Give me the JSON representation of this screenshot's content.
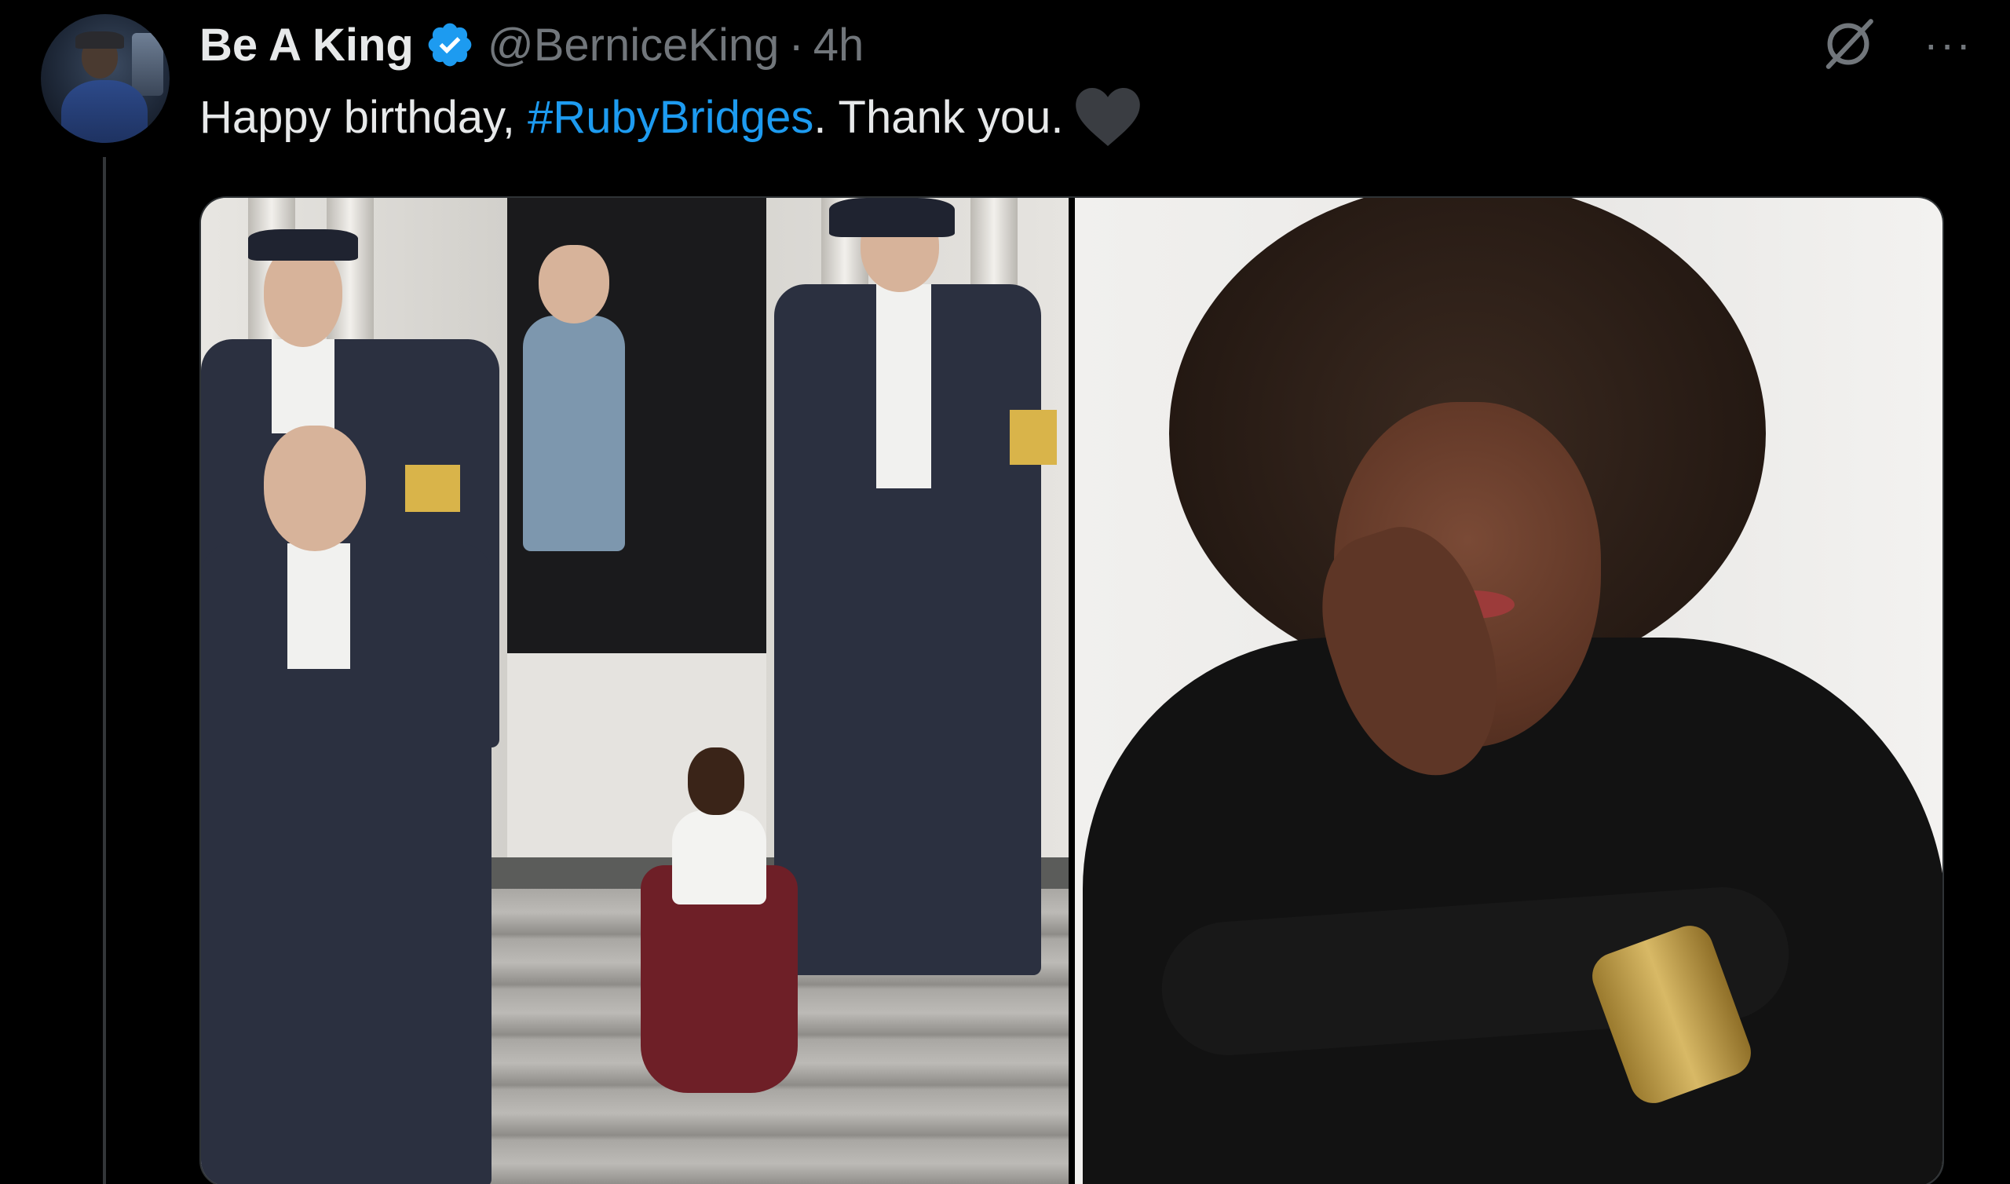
{
  "author": {
    "display_name": "Be A King",
    "handle": "@BerniceKing",
    "separator": "·",
    "time": "4h",
    "verified": true
  },
  "tweet": {
    "text_prefix": "Happy birthday, ",
    "hashtag": "#RubyBridges",
    "text_suffix": ". Thank you."
  },
  "actions": {
    "more_label": "···"
  },
  "icons": {
    "verified": "verified-badge-icon",
    "grok": "grok-icon",
    "more": "more-icon",
    "heart": "black-heart-emoji"
  },
  "colors": {
    "background": "#000000",
    "text": "#e7e9ea",
    "secondary": "#71767b",
    "accent": "#1d9bf0"
  }
}
